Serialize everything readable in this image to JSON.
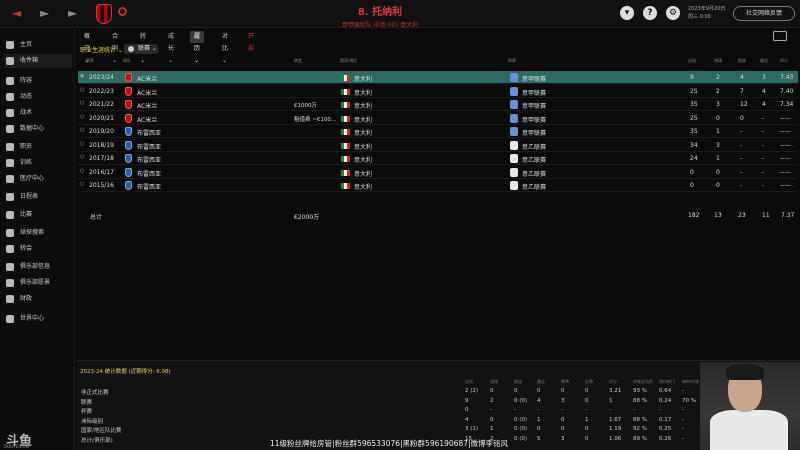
{
  "topbar": {
    "back": "◄",
    "forward": "►",
    "forward2": "►",
    "player_name": "8. 托纳利",
    "player_sub": "意甲国际队 中场 (中) 意大利",
    "date_line1": "2023年9月20日",
    "date_line2": "周三 0:00",
    "social_button": "社交网络反馈",
    "icons": [
      "shirt-icon",
      "help-icon",
      "settings-icon",
      "avatar-icon"
    ]
  },
  "sidebar": {
    "items": [
      {
        "label": "主页",
        "active": false
      },
      {
        "label": "收件箱",
        "active": true
      },
      {
        "label": "阵容",
        "active": false
      },
      {
        "label": "动态",
        "active": false
      },
      {
        "label": "战术",
        "active": false
      },
      {
        "label": "数据中心",
        "active": false
      },
      {
        "label": "职员",
        "active": false
      },
      {
        "label": "训练",
        "active": false
      },
      {
        "label": "医疗中心",
        "active": false
      },
      {
        "label": "日程表",
        "active": false
      },
      {
        "label": "比赛",
        "active": false
      },
      {
        "label": "球探搜索",
        "active": false
      },
      {
        "label": "转会",
        "active": false
      },
      {
        "label": "俱乐部信息",
        "active": false
      },
      {
        "label": "俱乐部愿景",
        "active": false
      },
      {
        "label": "财政",
        "active": false
      },
      {
        "label": "世界中心",
        "active": false
      }
    ]
  },
  "tabs": [
    {
      "label": "概况 ⌄",
      "active": false
    },
    {
      "label": "合同 ⌄",
      "active": false
    },
    {
      "label": "转会 ⌄",
      "active": false
    },
    {
      "label": "成长 ⌄",
      "active": false
    },
    {
      "label": "履历 ⌄",
      "active": true
    },
    {
      "label": "对比 ⌄",
      "active": false
    },
    {
      "label": "开启",
      "active": false,
      "red": true
    }
  ],
  "career": {
    "section_title": "职业生涯统计 ⌄",
    "filter_label": "联赛 ⌄",
    "headers": {
      "season": "赛季",
      "club": "球队",
      "fee": "转会",
      "nation": "国家/地区",
      "league": "联赛",
      "apps": "出场",
      "goals": "进球",
      "assists": "助攻",
      "pom": "最佳",
      "rating": "评分"
    },
    "rows": [
      {
        "season": "2023/24",
        "club": "AC米兰",
        "badge": "milan",
        "fee": "",
        "nation": "意大利",
        "league": "意甲联赛",
        "apps": "9",
        "goals": "2",
        "assists": "4",
        "pom": "3",
        "rating": "7.43",
        "selected": true
      },
      {
        "season": "2022/23",
        "club": "AC米兰",
        "badge": "milan",
        "fee": "",
        "nation": "意大利",
        "league": "意甲联赛",
        "apps": "25",
        "goals": "2",
        "assists": "7",
        "pom": "4",
        "rating": "7.40"
      },
      {
        "season": "2021/22",
        "club": "AC米兰",
        "badge": "milan",
        "fee": "€1000万",
        "nation": "意大利",
        "league": "意甲联赛",
        "apps": "35",
        "goals": "3",
        "assists": "12",
        "pom": "4",
        "rating": "7.34"
      },
      {
        "season": "2020/21",
        "club": "AC米兰",
        "badge": "milan",
        "fee": "租借费 ~€100...",
        "nation": "意大利",
        "league": "意甲联赛",
        "apps": "25",
        "goals": "0",
        "assists": "0",
        "pom": "-",
        "rating": "-----"
      },
      {
        "season": "2019/20",
        "club": "布雷西亚",
        "badge": "brescia",
        "fee": "",
        "nation": "意大利",
        "league": "意甲联赛",
        "apps": "35",
        "goals": "1",
        "assists": "-",
        "pom": "-",
        "rating": "-----"
      },
      {
        "season": "2018/19",
        "club": "布雷西亚",
        "badge": "brescia",
        "fee": "",
        "nation": "意大利",
        "league": "意乙联赛",
        "apps": "34",
        "goals": "3",
        "assists": "-",
        "pom": "-",
        "rating": "-----"
      },
      {
        "season": "2017/18",
        "club": "布雷西亚",
        "badge": "brescia",
        "fee": "",
        "nation": "意大利",
        "league": "意乙联赛",
        "apps": "24",
        "goals": "1",
        "assists": "-",
        "pom": "-",
        "rating": "-----"
      },
      {
        "season": "2016/17",
        "club": "布雷西亚",
        "badge": "brescia",
        "fee": "",
        "nation": "意大利",
        "league": "意乙联赛",
        "apps": "0",
        "goals": "0",
        "assists": "-",
        "pom": "-",
        "rating": "-----"
      },
      {
        "season": "2015/16",
        "club": "布雷西亚",
        "badge": "brescia",
        "fee": "",
        "nation": "意大利",
        "league": "意乙联赛",
        "apps": "0",
        "goals": "0",
        "assists": "-",
        "pom": "-",
        "rating": "-----"
      }
    ],
    "totals": {
      "label": "总计",
      "fee": "€2000万",
      "apps": "182",
      "goals": "13",
      "assists": "23",
      "pom": "11",
      "rating": "7.37"
    }
  },
  "stats_panel": {
    "title": "2023-24 统计数据 (近期得分: 6.98)",
    "headers": [
      "出场",
      "进球",
      "助攻",
      "最佳",
      "黄牌",
      "红牌",
      "评分",
      "传球成功率",
      "场均射门",
      "每90分钟",
      "平均评分"
    ],
    "rows": [
      {
        "label": "非正式比赛",
        "cells": [
          "2 (2)",
          "0",
          "0",
          "0",
          "0",
          "0",
          "3.21",
          "93 %",
          "0.64",
          "-",
          "6.87"
        ]
      },
      {
        "label": "联赛",
        "cells": [
          "9",
          "2",
          "0 (0)",
          "4",
          "3",
          "0",
          "1",
          "88 %",
          "0.24",
          "70 %",
          "7.43"
        ]
      },
      {
        "label": "杯赛",
        "cells": [
          "0",
          "-",
          "-",
          "-",
          "-",
          "-",
          "-",
          "-",
          "-",
          "-",
          "-"
        ]
      },
      {
        "label": "洲际级别",
        "cells": [
          "4",
          "0",
          "0 (0)",
          "1",
          "0",
          "1",
          "1.67",
          "88 %",
          "0.17",
          "-",
          "6.6"
        ]
      },
      {
        "label": "国家/地区队比赛",
        "cells": [
          "3 (1)",
          "1",
          "0 (0)",
          "0",
          "0",
          "0",
          "1.19",
          "92 %",
          "0.25",
          "-",
          "7.03"
        ]
      },
      {
        "label": "总计(俱乐部)",
        "cells": [
          "15",
          "2",
          "0 (0)",
          "5",
          "3",
          "0",
          "1.06",
          "89 %",
          "0.26",
          "-",
          "7.12"
        ]
      }
    ]
  },
  "overlay": {
    "banner": "11级粉丝牌给房管|粉丝群596533076|黑粉群596190687|微博李铭风",
    "logo": "斗鱼",
    "logo_sub": "DOUYU.COM"
  }
}
